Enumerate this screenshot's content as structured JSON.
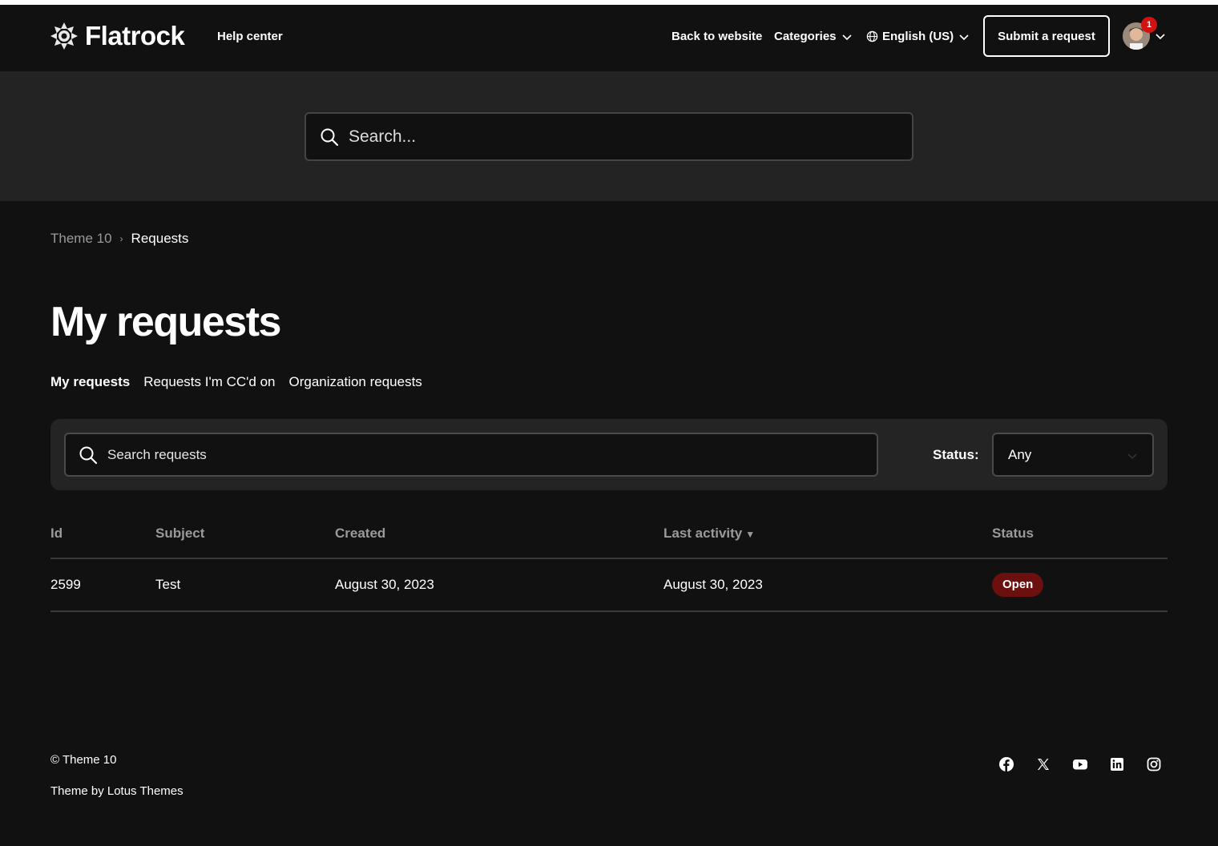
{
  "header": {
    "logo_text": "Flatrock",
    "help_center": "Help center",
    "nav": {
      "back_to_website": "Back to website",
      "categories": "Categories",
      "language": "English (US)"
    },
    "submit_request": "Submit a request",
    "notification_count": "1"
  },
  "hero": {
    "search_placeholder": "Search..."
  },
  "breadcrumb": {
    "root": "Theme 10",
    "separator": "›",
    "current": "Requests"
  },
  "page_title": "My requests",
  "tabs": [
    {
      "label": "My requests",
      "active": true
    },
    {
      "label": "Requests I'm CC'd on",
      "active": false
    },
    {
      "label": "Organization requests",
      "active": false
    }
  ],
  "filters": {
    "search_placeholder": "Search requests",
    "status_label": "Status:",
    "status_value": "Any"
  },
  "table": {
    "columns": [
      "Id",
      "Subject",
      "Created",
      "Last activity",
      "Status"
    ],
    "sort_indicator": "▼",
    "rows": [
      {
        "id": "2599",
        "subject": "Test",
        "created": "August 30, 2023",
        "last_activity": "August 30, 2023",
        "status": "Open"
      }
    ]
  },
  "footer": {
    "copyright": "© Theme 10",
    "byline": "Theme by Lotus Themes",
    "social": [
      "facebook-icon",
      "x-icon",
      "youtube-icon",
      "linkedin-icon",
      "instagram-icon"
    ]
  },
  "colors": {
    "background": "#111111",
    "hero_background": "#232323",
    "panel_background": "#242424",
    "status_open": "#6b0f0f",
    "badge": "#d01212"
  }
}
